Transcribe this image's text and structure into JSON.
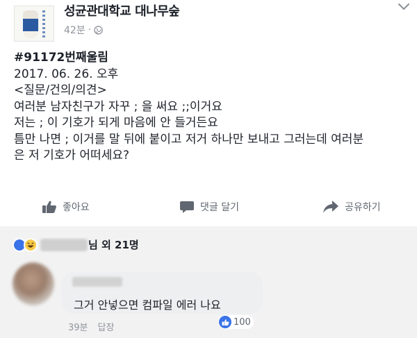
{
  "post": {
    "page_name": "성균관대학교 대나무숲",
    "time": "42분",
    "dot": "·",
    "lines": [
      "#91172번째울림",
      "2017. 06. 26. 오후",
      "<질문/건의/의견>",
      "여러분 남자친구가 자꾸 ; 을 써요 ;;이거요",
      "저는 ; 이 기호가 되게 마음에 안 들거든요",
      "틈만 나면 ; 이거를 말 뒤에 붙이고 저거 하나만 보내고 그러는데 여러분",
      "은 저 기호가 어떠세요?"
    ]
  },
  "actions": {
    "like_label": "좋아요",
    "comment_label": "댓글 달기",
    "share_label": "공유하기"
  },
  "reactions": {
    "summary": "님 외 21명"
  },
  "comment": {
    "text": "그거 안넣으면 컴파일 에러 나요",
    "time": "39분",
    "reply_label": "답장",
    "like_count": "100"
  },
  "colors": {
    "accent": "#3b73e8",
    "muted": "#90949c",
    "text": "#1d2129"
  }
}
